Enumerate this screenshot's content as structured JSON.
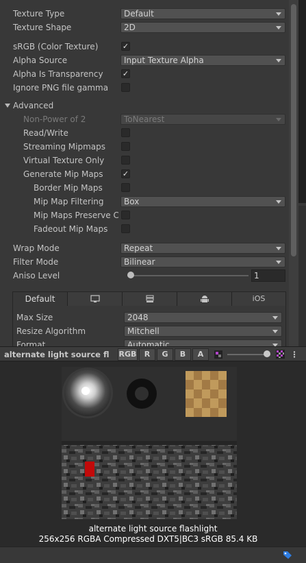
{
  "texture": {
    "type": {
      "label": "Texture Type",
      "value": "Default"
    },
    "shape": {
      "label": "Texture Shape",
      "value": "2D"
    },
    "srgb": {
      "label": "sRGB (Color Texture)",
      "checked": true
    },
    "alpha_source": {
      "label": "Alpha Source",
      "value": "Input Texture Alpha"
    },
    "alpha_is_transparency": {
      "label": "Alpha Is Transparency",
      "checked": true
    },
    "ignore_png_gamma": {
      "label": "Ignore PNG file gamma",
      "checked": false
    }
  },
  "advanced": {
    "label": "Advanced",
    "npot": {
      "label": "Non-Power of 2",
      "value": "ToNearest"
    },
    "read_write": {
      "label": "Read/Write",
      "checked": false
    },
    "streaming_mipmaps": {
      "label": "Streaming Mipmaps",
      "checked": false
    },
    "virtual_texture_only": {
      "label": "Virtual Texture Only",
      "checked": false
    },
    "generate_mip_maps": {
      "label": "Generate Mip Maps",
      "checked": true
    },
    "border_mip_maps": {
      "label": "Border Mip Maps",
      "checked": false
    },
    "mip_map_filtering": {
      "label": "Mip Map Filtering",
      "value": "Box"
    },
    "mip_maps_preserve_coverage": {
      "label": "Mip Maps Preserve Co",
      "checked": false
    },
    "fadeout_mip_maps": {
      "label": "Fadeout Mip Maps",
      "checked": false
    }
  },
  "wrap_mode": {
    "label": "Wrap Mode",
    "value": "Repeat"
  },
  "filter_mode": {
    "label": "Filter Mode",
    "value": "Bilinear"
  },
  "aniso_level": {
    "label": "Aniso Level",
    "value": "1",
    "level_fraction": 0.0
  },
  "platform_tabs": [
    {
      "label": "Default",
      "icon": "",
      "selected": true
    },
    {
      "label": "",
      "icon": "monitor-icon"
    },
    {
      "label": "",
      "icon": "server-icon"
    },
    {
      "label": "",
      "icon": "android-icon"
    },
    {
      "label": "iOS",
      "icon": ""
    }
  ],
  "platform": {
    "max_size": {
      "label": "Max Size",
      "value": "2048"
    },
    "resize_algorithm": {
      "label": "Resize Algorithm",
      "value": "Mitchell"
    },
    "format": {
      "label": "Format",
      "value": "Automatic"
    }
  },
  "preview": {
    "title": "alternate light source fl",
    "channels": [
      "RGB",
      "R",
      "G",
      "B",
      "A"
    ],
    "mip_level_fraction": 1.0,
    "name": "alternate light source flashlight",
    "info": "256x256  RGBA Compressed DXT5|BC3 sRGB  85.4 KB"
  },
  "colors": {
    "panel_bg": "#383838",
    "field_bg": "#515151",
    "preview_bg": "#2a2a2a",
    "checker": "#a6844f",
    "red_accent": "#c20a0a",
    "tag_blue": "#2f7de1"
  }
}
